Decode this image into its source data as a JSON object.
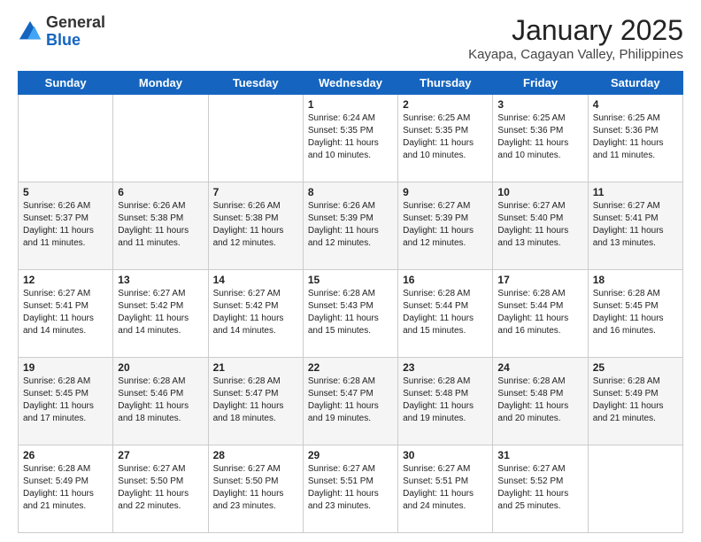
{
  "header": {
    "logo_general": "General",
    "logo_blue": "Blue",
    "month_title": "January 2025",
    "location": "Kayapa, Cagayan Valley, Philippines"
  },
  "weekdays": [
    "Sunday",
    "Monday",
    "Tuesday",
    "Wednesday",
    "Thursday",
    "Friday",
    "Saturday"
  ],
  "weeks": [
    [
      {
        "day": "",
        "info": ""
      },
      {
        "day": "",
        "info": ""
      },
      {
        "day": "",
        "info": ""
      },
      {
        "day": "1",
        "info": "Sunrise: 6:24 AM\nSunset: 5:35 PM\nDaylight: 11 hours and 10 minutes."
      },
      {
        "day": "2",
        "info": "Sunrise: 6:25 AM\nSunset: 5:35 PM\nDaylight: 11 hours and 10 minutes."
      },
      {
        "day": "3",
        "info": "Sunrise: 6:25 AM\nSunset: 5:36 PM\nDaylight: 11 hours and 10 minutes."
      },
      {
        "day": "4",
        "info": "Sunrise: 6:25 AM\nSunset: 5:36 PM\nDaylight: 11 hours and 11 minutes."
      }
    ],
    [
      {
        "day": "5",
        "info": "Sunrise: 6:26 AM\nSunset: 5:37 PM\nDaylight: 11 hours and 11 minutes."
      },
      {
        "day": "6",
        "info": "Sunrise: 6:26 AM\nSunset: 5:38 PM\nDaylight: 11 hours and 11 minutes."
      },
      {
        "day": "7",
        "info": "Sunrise: 6:26 AM\nSunset: 5:38 PM\nDaylight: 11 hours and 12 minutes."
      },
      {
        "day": "8",
        "info": "Sunrise: 6:26 AM\nSunset: 5:39 PM\nDaylight: 11 hours and 12 minutes."
      },
      {
        "day": "9",
        "info": "Sunrise: 6:27 AM\nSunset: 5:39 PM\nDaylight: 11 hours and 12 minutes."
      },
      {
        "day": "10",
        "info": "Sunrise: 6:27 AM\nSunset: 5:40 PM\nDaylight: 11 hours and 13 minutes."
      },
      {
        "day": "11",
        "info": "Sunrise: 6:27 AM\nSunset: 5:41 PM\nDaylight: 11 hours and 13 minutes."
      }
    ],
    [
      {
        "day": "12",
        "info": "Sunrise: 6:27 AM\nSunset: 5:41 PM\nDaylight: 11 hours and 14 minutes."
      },
      {
        "day": "13",
        "info": "Sunrise: 6:27 AM\nSunset: 5:42 PM\nDaylight: 11 hours and 14 minutes."
      },
      {
        "day": "14",
        "info": "Sunrise: 6:27 AM\nSunset: 5:42 PM\nDaylight: 11 hours and 14 minutes."
      },
      {
        "day": "15",
        "info": "Sunrise: 6:28 AM\nSunset: 5:43 PM\nDaylight: 11 hours and 15 minutes."
      },
      {
        "day": "16",
        "info": "Sunrise: 6:28 AM\nSunset: 5:44 PM\nDaylight: 11 hours and 15 minutes."
      },
      {
        "day": "17",
        "info": "Sunrise: 6:28 AM\nSunset: 5:44 PM\nDaylight: 11 hours and 16 minutes."
      },
      {
        "day": "18",
        "info": "Sunrise: 6:28 AM\nSunset: 5:45 PM\nDaylight: 11 hours and 16 minutes."
      }
    ],
    [
      {
        "day": "19",
        "info": "Sunrise: 6:28 AM\nSunset: 5:45 PM\nDaylight: 11 hours and 17 minutes."
      },
      {
        "day": "20",
        "info": "Sunrise: 6:28 AM\nSunset: 5:46 PM\nDaylight: 11 hours and 18 minutes."
      },
      {
        "day": "21",
        "info": "Sunrise: 6:28 AM\nSunset: 5:47 PM\nDaylight: 11 hours and 18 minutes."
      },
      {
        "day": "22",
        "info": "Sunrise: 6:28 AM\nSunset: 5:47 PM\nDaylight: 11 hours and 19 minutes."
      },
      {
        "day": "23",
        "info": "Sunrise: 6:28 AM\nSunset: 5:48 PM\nDaylight: 11 hours and 19 minutes."
      },
      {
        "day": "24",
        "info": "Sunrise: 6:28 AM\nSunset: 5:48 PM\nDaylight: 11 hours and 20 minutes."
      },
      {
        "day": "25",
        "info": "Sunrise: 6:28 AM\nSunset: 5:49 PM\nDaylight: 11 hours and 21 minutes."
      }
    ],
    [
      {
        "day": "26",
        "info": "Sunrise: 6:28 AM\nSunset: 5:49 PM\nDaylight: 11 hours and 21 minutes."
      },
      {
        "day": "27",
        "info": "Sunrise: 6:27 AM\nSunset: 5:50 PM\nDaylight: 11 hours and 22 minutes."
      },
      {
        "day": "28",
        "info": "Sunrise: 6:27 AM\nSunset: 5:50 PM\nDaylight: 11 hours and 23 minutes."
      },
      {
        "day": "29",
        "info": "Sunrise: 6:27 AM\nSunset: 5:51 PM\nDaylight: 11 hours and 23 minutes."
      },
      {
        "day": "30",
        "info": "Sunrise: 6:27 AM\nSunset: 5:51 PM\nDaylight: 11 hours and 24 minutes."
      },
      {
        "day": "31",
        "info": "Sunrise: 6:27 AM\nSunset: 5:52 PM\nDaylight: 11 hours and 25 minutes."
      },
      {
        "day": "",
        "info": ""
      }
    ]
  ]
}
